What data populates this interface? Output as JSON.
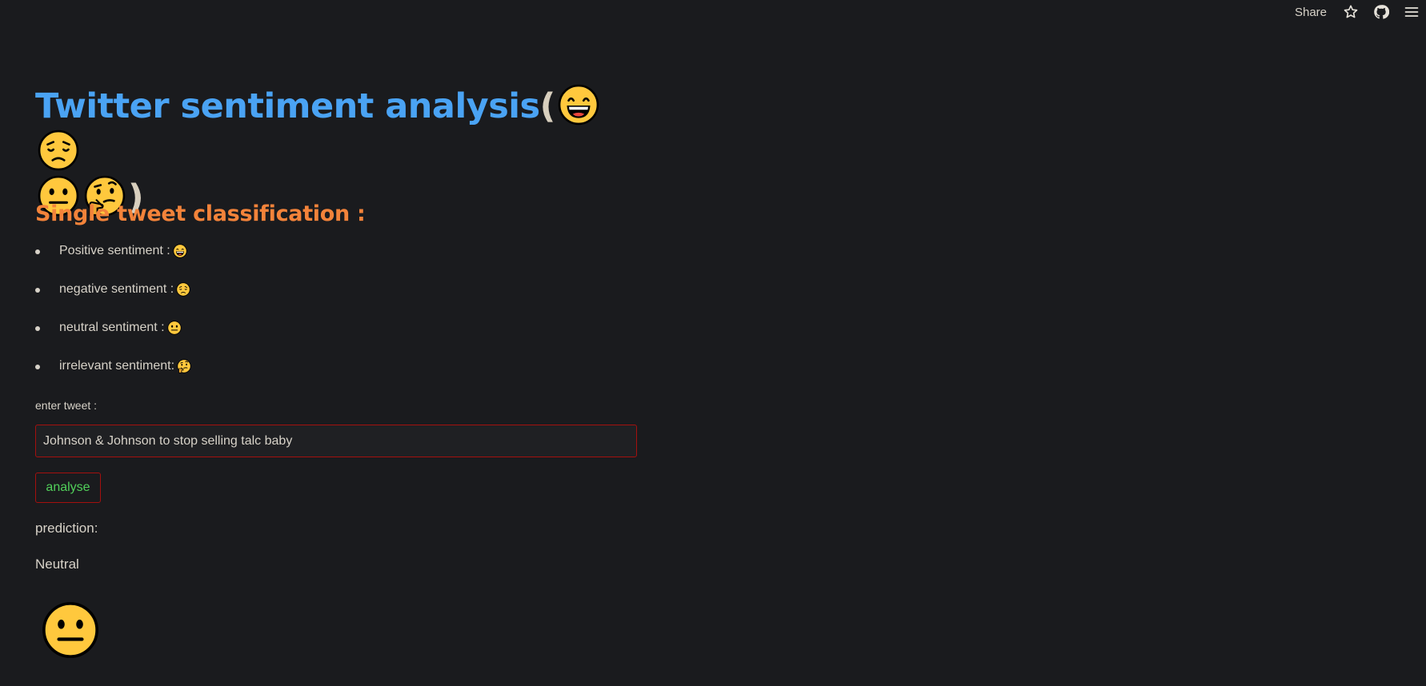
{
  "toolbar": {
    "share_label": "Share",
    "icons": [
      "star-icon",
      "github-icon",
      "hamburger-menu-icon"
    ]
  },
  "header": {
    "title": "Twitter sentiment analysis",
    "open_paren": "(",
    "close_paren": ")",
    "title_emojis": [
      "grinning-face-icon",
      "disappointed-face-icon",
      "neutral-face-icon",
      "thinking-face-icon"
    ]
  },
  "section": {
    "subtitle": "Single tweet classification :"
  },
  "legend": [
    {
      "label": "Positive sentiment :",
      "emoji": "grinning-face-icon"
    },
    {
      "label": "negative sentiment :",
      "emoji": "disappointed-face-icon"
    },
    {
      "label": "neutral sentiment :",
      "emoji": "neutral-face-icon"
    },
    {
      "label": "irrelevant sentiment:",
      "emoji": "thinking-face-icon"
    }
  ],
  "form": {
    "label": "enter tweet :",
    "value": "Johnson & Johnson to stop selling talc baby",
    "button_label": "analyse"
  },
  "result": {
    "label": "prediction:",
    "value": "Neutral",
    "emoji": "neutral-face-icon"
  },
  "colors": {
    "background": "#1a1b1e",
    "title": "#4aa3f4",
    "subtitle": "#f3833a",
    "text": "#d7d2c8",
    "accent_border": "#a4100e",
    "button_text": "#51d05a",
    "emoji_yellow": "#ffc83d"
  }
}
